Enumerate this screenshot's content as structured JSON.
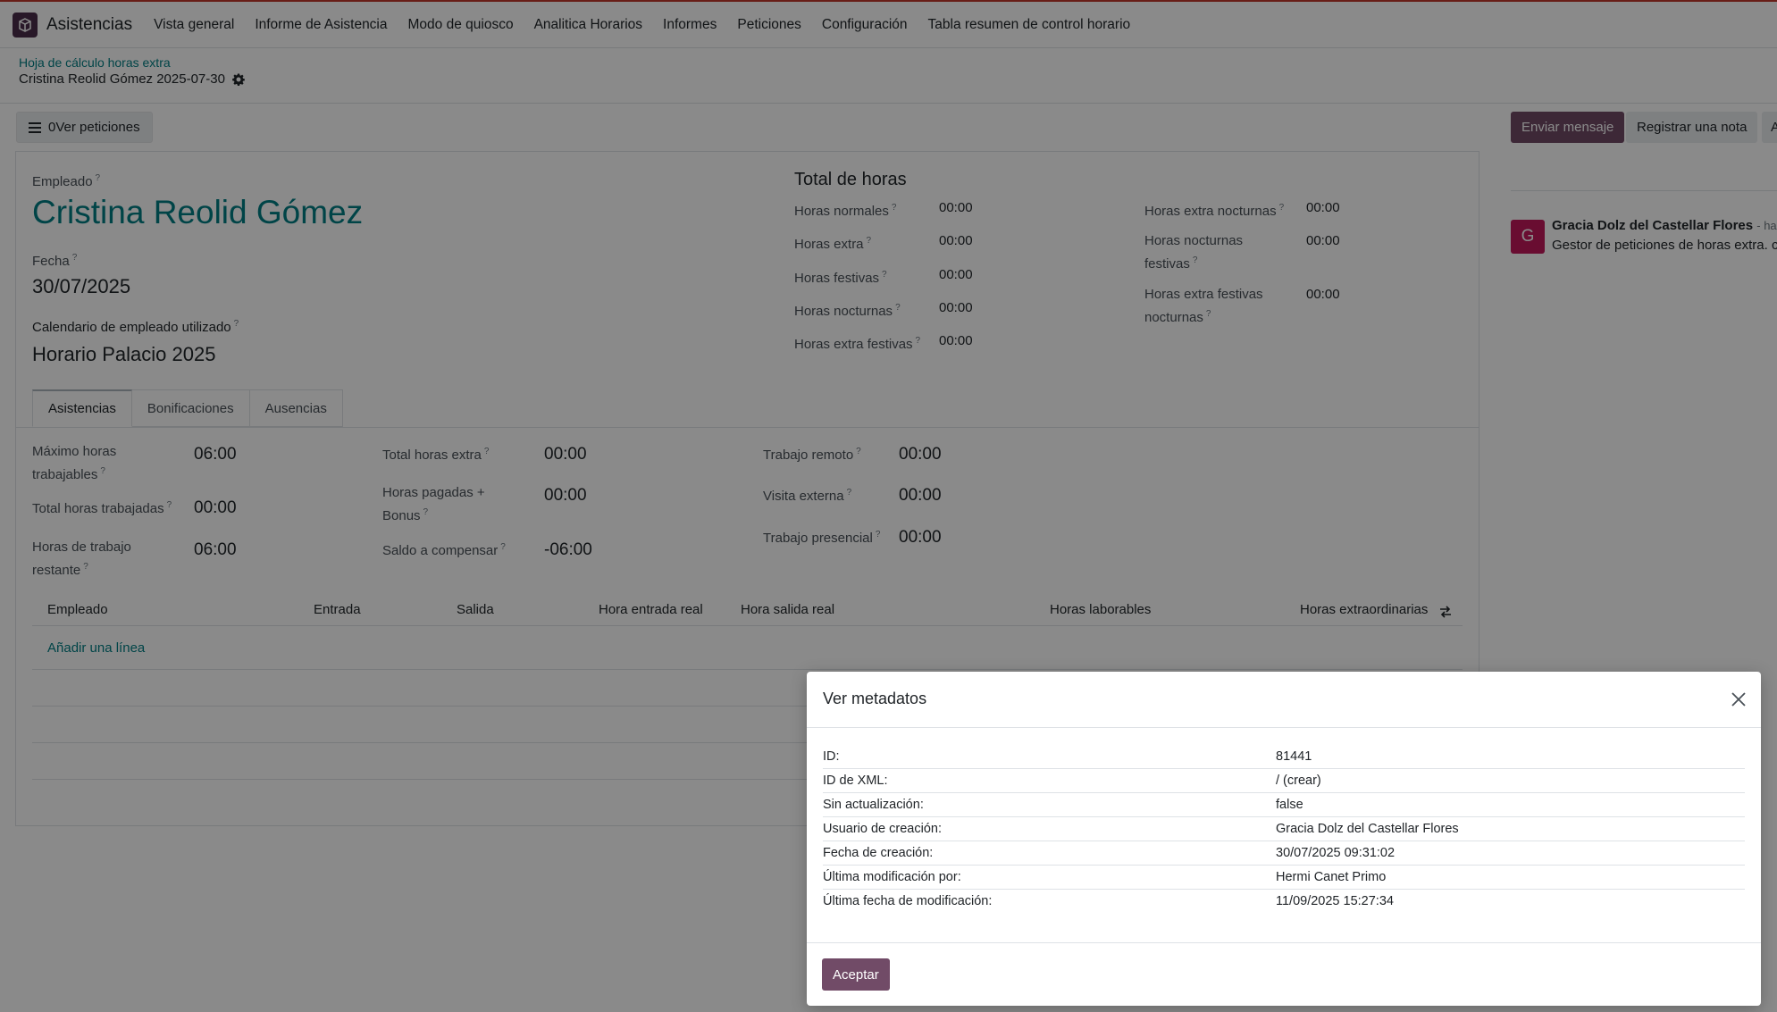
{
  "navbar": {
    "app_name": "Asistencias",
    "menu": [
      "Vista general",
      "Informe de Asistencia",
      "Modo de quiosco",
      "Analitica Horarios",
      "Informes",
      "Peticiones",
      "Configuración",
      "Tabla resumen de control horario"
    ]
  },
  "breadcrumb": {
    "parent": "Hoja de cálculo horas extra",
    "current": "Cristina Reolid Gómez 2025-07-30"
  },
  "buttons": {
    "requests": "0Ver peticiones",
    "send_message": "Enviar mensaje",
    "log_note": "Registrar una nota",
    "extra": "A"
  },
  "form": {
    "employee_label": "Empleado",
    "employee_name": "Cristina Reolid Gómez",
    "date_label": "Fecha",
    "date_value": "30/07/2025",
    "calendar_label": "Calendario de empleado utilizado",
    "calendar_value": "Horario Palacio 2025",
    "hours_title": "Total de horas",
    "hours_left": [
      {
        "label": "Horas normales",
        "value": "00:00"
      },
      {
        "label": "Horas extra",
        "value": "00:00"
      },
      {
        "label": "Horas festivas",
        "value": "00:00"
      },
      {
        "label": "Horas nocturnas",
        "value": "00:00"
      },
      {
        "label": "Horas extra festivas",
        "value": "00:00"
      }
    ],
    "hours_right": [
      {
        "label1": "Horas extra nocturnas",
        "label2": "",
        "value": "00:00"
      },
      {
        "label1": "Horas nocturnas",
        "label2": "festivas",
        "value": "00:00"
      },
      {
        "label1": "Horas extra festivas",
        "label2": "nocturnas",
        "value": "00:00"
      }
    ]
  },
  "tabs": [
    "Asistencias",
    "Bonificaciones",
    "Ausencias"
  ],
  "attendance": {
    "col1": [
      {
        "label1": "Máximo horas",
        "label2": "trabajables",
        "value": "06:00"
      },
      {
        "label1": "Total horas trabajadas",
        "label2": "",
        "value": "00:00"
      },
      {
        "label1": "Horas de trabajo",
        "label2": "restante",
        "value": "06:00"
      }
    ],
    "col2": [
      {
        "label1": "Total horas extra",
        "label2": "",
        "value": "00:00"
      },
      {
        "label1": "Horas pagadas +",
        "label2": "Bonus",
        "value": "00:00"
      },
      {
        "label1": "Saldo a compensar",
        "label2": "",
        "value": "-06:00"
      }
    ],
    "col3": [
      {
        "label1": "Trabajo remoto",
        "label2": "",
        "value": "00:00"
      },
      {
        "label1": "Visita externa",
        "label2": "",
        "value": "00:00"
      },
      {
        "label1": "Trabajo presencial",
        "label2": "",
        "value": "00:00"
      }
    ]
  },
  "table": {
    "headers": [
      "Empleado",
      "Entrada",
      "Salida",
      "Hora entrada real",
      "Hora salida real",
      "Horas laborables",
      "Horas extraordinarias"
    ],
    "add_line": "Añadir una línea"
  },
  "chatter": {
    "avatar_letter": "G",
    "author": "Gracia Dolz del Castellar Flores",
    "time": "- hac",
    "body": "Gestor de peticiones de horas extra. c"
  },
  "modal": {
    "title": "Ver metadatos",
    "rows": [
      {
        "key": "ID:",
        "value": "81441"
      },
      {
        "key": "ID de XML:",
        "value": "/  (crear)"
      },
      {
        "key": "Sin actualización:",
        "value": "false"
      },
      {
        "key": "Usuario de creación:",
        "value": "Gracia Dolz del Castellar Flores"
      },
      {
        "key": "Fecha de creación:",
        "value": "30/07/2025 09:31:02"
      },
      {
        "key": "Última modificación por:",
        "value": "Hermi Canet Primo"
      },
      {
        "key": "Última fecha de modificación:",
        "value": "11/09/2025 15:27:34"
      }
    ],
    "accept": "Aceptar"
  },
  "colors": {
    "primary": "#714b67",
    "link": "#017e84",
    "avatar": "#c2185b"
  }
}
